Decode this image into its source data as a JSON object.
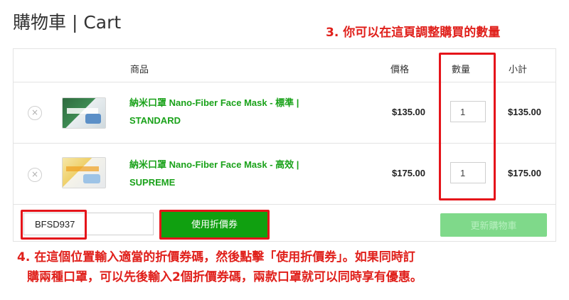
{
  "page": {
    "title": "購物車 | Cart"
  },
  "annotations": {
    "qty_note": "3. 你可以在這頁調整購買的數量",
    "coupon_note_line1": "4. 在這個位置輸入適當的折價券碼，然後點擊「使用折價券」。如果同時訂",
    "coupon_note_line2": "購兩種口罩，可以先後輸入2個折價券碼，兩款口罩就可以同時享有優惠。"
  },
  "table": {
    "headers": {
      "product": "商品",
      "price": "價格",
      "quantity": "數量",
      "subtotal": "小計"
    },
    "rows": [
      {
        "name_line1": "納米口罩 Nano-Fiber Face Mask - 標準 |",
        "name_line2": "STANDARD",
        "price": "$135.00",
        "quantity": "1",
        "subtotal": "$135.00",
        "remove_symbol": "×",
        "thumb_icon": "face-mask-box-standard"
      },
      {
        "name_line1": "納米口罩 Nano-Fiber Face Mask - 高效 |",
        "name_line2": "SUPREME",
        "price": "$175.00",
        "quantity": "1",
        "subtotal": "$175.00",
        "remove_symbol": "×",
        "thumb_icon": "face-mask-box-supreme"
      }
    ]
  },
  "coupon": {
    "code_value": "BFSD937",
    "apply_label": "使用折價券",
    "update_cart_label": "更新購物車"
  },
  "colors": {
    "product_link": "#1aa21a",
    "apply_button": "#10a010",
    "update_button": "#7fd98a",
    "annotation": "#e0201b",
    "highlight_border": "#e5141a"
  }
}
